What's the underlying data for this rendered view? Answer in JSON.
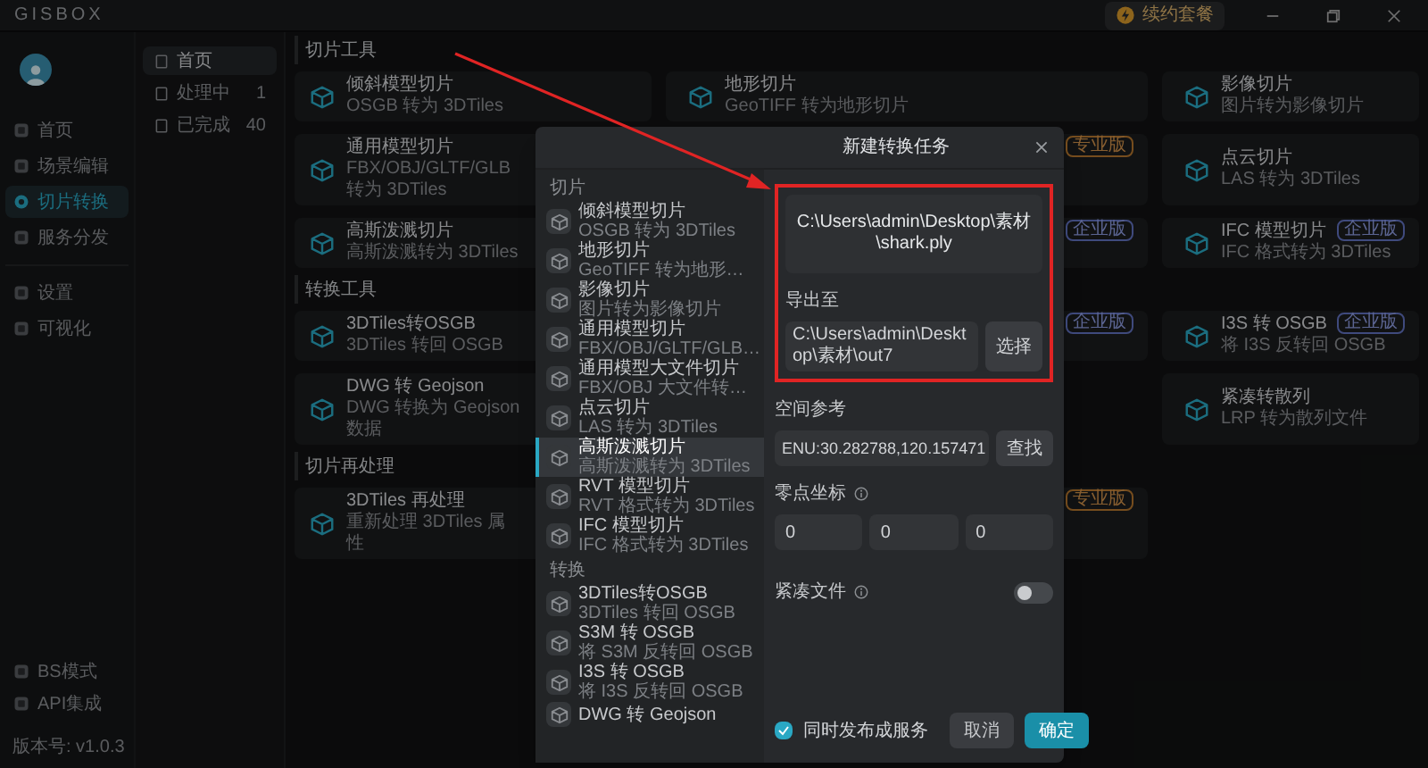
{
  "app": {
    "logo": "GISBOX",
    "renew_button": "续约套餐"
  },
  "nav": [
    {
      "label": "首页",
      "selected": false
    },
    {
      "label": "场景编辑",
      "selected": false
    },
    {
      "label": "切片转换",
      "selected": true
    },
    {
      "label": "服务分发",
      "selected": false
    },
    {
      "label": "设置",
      "selected": false
    },
    {
      "label": "可视化",
      "selected": false
    }
  ],
  "nav_footer": [
    {
      "label": "BS模式"
    },
    {
      "label": "API集成"
    }
  ],
  "version": "版本号: v1.0.3",
  "task_menu": [
    {
      "label": "首页",
      "selected": true
    },
    {
      "label": "处理中",
      "count": "1",
      "selected": false
    },
    {
      "label": "已完成",
      "count": "40",
      "selected": false
    }
  ],
  "sections": [
    {
      "title": "切片工具",
      "rows": [
        {
          "column_1": {
            "title": "倾斜模型切片",
            "subtitle": "OSGB 转为 3DTiles"
          },
          "column_2": {
            "title": "地形切片",
            "subtitle": "GeoTIFF 转为地形切片"
          },
          "column_3": {
            "title": "影像切片",
            "subtitle": "图片转为影像切片"
          }
        },
        {
          "column_1": {
            "title": "通用模型切片",
            "subtitle": "FBX/OBJ/GLTF/GLB 转为 3DTiles"
          },
          "column_2": {
            "badge": "专业版",
            "kind": "pro"
          },
          "column_3": {
            "title": "点云切片",
            "subtitle": "LAS 转为 3DTiles"
          }
        },
        {
          "column_1": {
            "title": "高斯泼溅切片",
            "subtitle": "高斯泼溅转为 3DTiles"
          },
          "column_2": {
            "badge": "企业版",
            "kind": "enterprise"
          },
          "column_3": {
            "title": "IFC 模型切片",
            "subtitle": "IFC 格式转为 3DTiles",
            "badge": "企业版",
            "kind": "enterprise"
          }
        }
      ]
    },
    {
      "title": "转换工具",
      "rows": [
        {
          "column_1": {
            "title": "3DTiles转OSGB",
            "subtitle": "3DTiles 转回 OSGB"
          },
          "column_2": {
            "badge": "企业版",
            "kind": "enterprise"
          },
          "column_3": {
            "title": "I3S 转 OSGB",
            "subtitle": "将 I3S 反转回 OSGB",
            "badge": "企业版",
            "kind": "enterprise"
          }
        },
        {
          "column_1": {
            "title": "DWG 转 Geojson",
            "subtitle": "DWG 转换为 Geojson 数据"
          },
          "column_3": {
            "title": "紧凑转散列",
            "subtitle": "LRP 转为散列文件"
          }
        }
      ]
    },
    {
      "title": "切片再处理",
      "rows": [
        {
          "column_1": {
            "title": "3DTiles 再处理",
            "subtitle": "重新处理 3DTiles 属性"
          },
          "column_2": {
            "badge": "专业版",
            "kind": "pro"
          }
        }
      ]
    }
  ],
  "dialog": {
    "title": "新建转换任务",
    "groups": [
      {
        "label": "切片",
        "items": [
          {
            "title": "倾斜模型切片",
            "subtitle": "OSGB 转为 3DTiles",
            "selected": false
          },
          {
            "title": "地形切片",
            "subtitle": "GeoTIFF 转为地形…",
            "selected": false
          },
          {
            "title": "影像切片",
            "subtitle": "图片转为影像切片",
            "selected": false
          },
          {
            "title": "通用模型切片",
            "subtitle": "FBX/OBJ/GLTF/GLB…",
            "selected": false
          },
          {
            "title": "通用模型大文件切片",
            "subtitle": "FBX/OBJ 大文件转…",
            "selected": false
          },
          {
            "title": "点云切片",
            "subtitle": "LAS 转为 3DTiles",
            "selected": false
          },
          {
            "title": "高斯泼溅切片",
            "subtitle": "高斯泼溅转为 3DTiles",
            "selected": true
          },
          {
            "title": "RVT 模型切片",
            "subtitle": "RVT 格式转为 3DTiles",
            "selected": false
          },
          {
            "title": "IFC 模型切片",
            "subtitle": "IFC 格式转为 3DTiles",
            "selected": false
          }
        ]
      },
      {
        "label": "转换",
        "items": [
          {
            "title": "3DTiles转OSGB",
            "subtitle": "3DTiles 转回 OSGB",
            "selected": false
          },
          {
            "title": "S3M 转 OSGB",
            "subtitle": "将 S3M 反转回 OSGB",
            "selected": false
          },
          {
            "title": "I3S 转 OSGB",
            "subtitle": "将 I3S 反转回 OSGB",
            "selected": false
          },
          {
            "title": "DWG 转 Geojson",
            "selected": false
          }
        ]
      }
    ],
    "source_file": "C:\\Users\\admin\\Desktop\\素材\\shark.ply",
    "export": {
      "label": "导出至",
      "value": "C:\\Users\\admin\\Desktop\\素材\\out7",
      "button": "选择"
    },
    "spatial_ref": {
      "label": "空间参考",
      "value": "ENU:30.282788,120.157471",
      "button": "查找"
    },
    "origin": {
      "label": "零点坐标",
      "values": [
        "0",
        "0",
        "0"
      ]
    },
    "compact": {
      "label": "紧凑文件",
      "on": false
    },
    "publish": {
      "label": "同时发布成服务",
      "checked": true
    },
    "cancel_button": "取消",
    "ok_button": "确定"
  }
}
